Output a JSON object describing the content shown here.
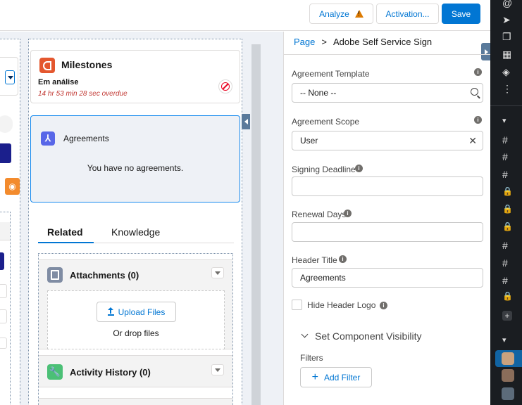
{
  "toolbar": {
    "analyze_label": "Analyze",
    "activation_label": "Activation...",
    "save_label": "Save"
  },
  "milestones": {
    "title": "Milestones",
    "status": "Em análise",
    "overdue": "14 hr 53 min 28 sec overdue"
  },
  "agreements": {
    "title": "Agreements",
    "empty": "You have no agreements."
  },
  "tabs": [
    {
      "label": "Related"
    },
    {
      "label": "Knowledge"
    }
  ],
  "attachments": {
    "title": "Attachments (0)",
    "upload_label": "Upload Files",
    "drop_label": "Or drop files"
  },
  "activity": {
    "title": "Activity History (0)"
  },
  "props": {
    "breadcrumb_page": "Page",
    "breadcrumb_sep": ">",
    "breadcrumb_current": "Adobe Self Service Sign",
    "fields": {
      "agreement_template": {
        "label": "Agreement Template",
        "value": "-- None --"
      },
      "agreement_scope": {
        "label": "Agreement Scope",
        "value": "User"
      },
      "signing_deadline": {
        "label": "Signing Deadline",
        "value": ""
      },
      "renewal_days": {
        "label": "Renewal Days",
        "value": ""
      },
      "header_title": {
        "label": "Header Title",
        "value": "Agreements"
      }
    },
    "hide_header_logo_label": "Hide Header Logo",
    "visibility_label": "Set Component Visibility",
    "filters_label": "Filters",
    "add_filter_label": "Add Filter"
  },
  "colors": {
    "brand": "#0176d3",
    "overdue": "#c23934",
    "milestone_icon": "#e4572e",
    "agreement_icon": "#5867e8",
    "activity_icon": "#4bc076",
    "dark_sidebar": "#1a1d21"
  },
  "dark_sidebar": {
    "items": [
      "@",
      "➤",
      "❐",
      "▦",
      "◈",
      "⋮",
      "▾",
      "#",
      "#",
      "#",
      "🔒",
      "🔒",
      "🔒",
      "#",
      "#",
      "#",
      "🔒",
      "+",
      "▾"
    ]
  }
}
